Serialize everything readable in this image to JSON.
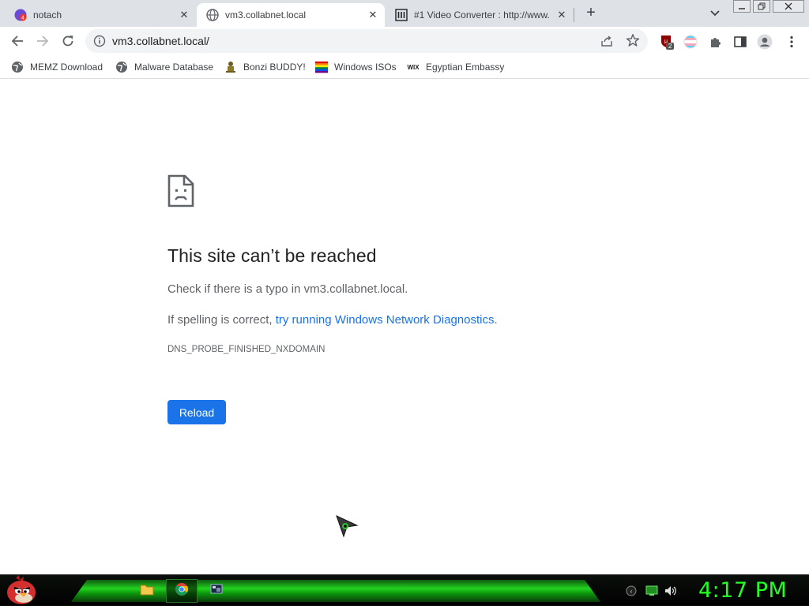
{
  "window": {
    "tabs": [
      {
        "title": "notach",
        "favicon": "notach-favicon"
      },
      {
        "title": "vm3.collabnet.local",
        "favicon": "globe-icon"
      },
      {
        "title": "#1 Video Converter : http://www.",
        "favicon": "museum-icon"
      }
    ],
    "new_tab": "+"
  },
  "toolbar": {
    "url": "vm3.collabnet.local/",
    "extension_badge": "2"
  },
  "bookmarks": [
    {
      "label": "MEMZ Download",
      "icon": "globe-icon"
    },
    {
      "label": "Malware Database",
      "icon": "globe-icon"
    },
    {
      "label": "Bonzi BUDDY!",
      "icon": "bonzi-icon"
    },
    {
      "label": "Windows ISOs",
      "icon": "rainbow-flag-icon"
    },
    {
      "label": "Egyptian Embassy",
      "icon": "wix-icon"
    }
  ],
  "error": {
    "title": "This site can’t be reached",
    "line1": "Check if there is a typo in vm3.collabnet.local.",
    "line2_prefix": "If spelling is correct, ",
    "line2_link": "try running Windows Network Diagnostics",
    "line2_suffix": ".",
    "code": "DNS_PROBE_FINISHED_NXDOMAIN",
    "reload": "Reload"
  },
  "wix_text": "WIX",
  "taskbar": {
    "clock": "4:17 PM"
  },
  "colors": {
    "accent": "#1a73e8",
    "clock": "#22ff22",
    "taskbar_glow": "#23d21f"
  }
}
